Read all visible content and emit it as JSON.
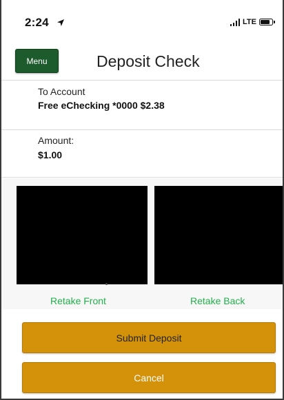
{
  "status_bar": {
    "time": "2:24",
    "network": "LTE",
    "icons": {
      "location": "location-arrow-icon",
      "signal": "signal-bars-icon",
      "battery": "battery-icon"
    }
  },
  "header": {
    "menu_label": "Menu",
    "title": "Deposit Check"
  },
  "account": {
    "label": "To Account",
    "value": "Free eChecking *0000 $2.38"
  },
  "amount": {
    "label": "Amount:",
    "value": "$1.00"
  },
  "images": {
    "retake_front": "Retake Front",
    "retake_back": "Retake Back"
  },
  "actions": {
    "submit": "Submit Deposit",
    "cancel": "Cancel"
  },
  "colors": {
    "menu_green": "#1d5a2c",
    "link_green": "#22b04b",
    "button_gold": "#d4920a"
  }
}
